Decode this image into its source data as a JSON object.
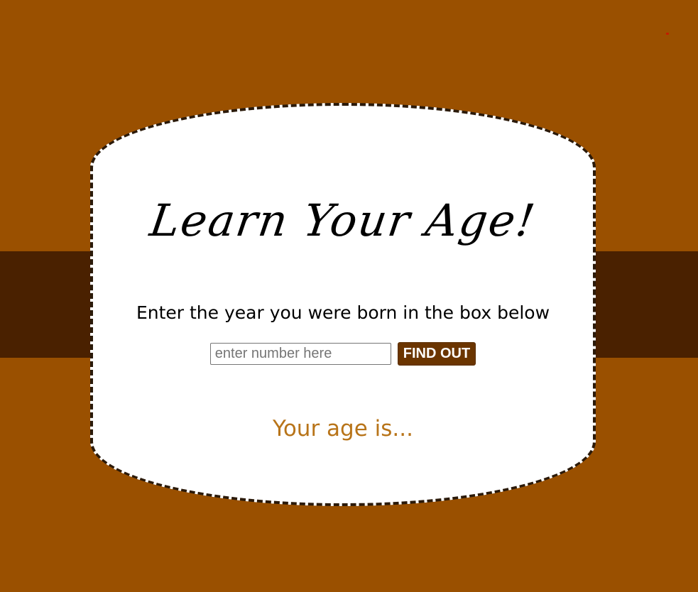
{
  "page": {
    "title": "Learn Your Age!",
    "instruction": "Enter the year you were born in the box below",
    "input": {
      "placeholder": "enter number here",
      "value": ""
    },
    "button_label": "FIND OUT",
    "result_text": "Your age is..."
  },
  "colors": {
    "background": "#9a5000",
    "band": "#4a2100",
    "card": "#ffffff",
    "card_border": "#2b1a0a",
    "button": "#6b3500",
    "result_text": "#b87419"
  }
}
